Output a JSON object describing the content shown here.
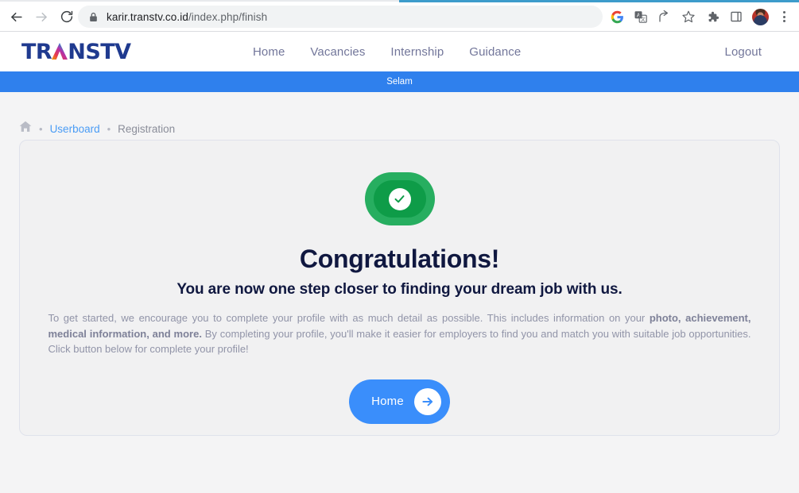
{
  "browser": {
    "back_label": "Back",
    "forward_label": "Forward",
    "reload_label": "Reload",
    "url_host_strong": "karir.transtv.co.id",
    "url_path": "/index.php/finish",
    "url_full": "karir.transtv.co.id/index.php/finish",
    "icons": [
      "google-icon",
      "translate-icon",
      "share-icon",
      "bookmark-star-icon",
      "extensions-puzzle-icon",
      "side-panel-icon",
      "profile-avatar",
      "chrome-menu-icon"
    ]
  },
  "site_header": {
    "brand_part1": "TR",
    "brand_part_a": "A",
    "brand_part2": "NS",
    "brand_part3": "TV",
    "brand_full": "TRANSTV",
    "nav": [
      {
        "label": "Home"
      },
      {
        "label": "Vacancies"
      },
      {
        "label": "Internship"
      },
      {
        "label": "Guidance"
      }
    ],
    "logout_label": "Logout"
  },
  "alert_banner": {
    "message": "Selam",
    "color": "#2f80ed"
  },
  "breadcrumb": {
    "home_icon": "home-icon",
    "separator": "•",
    "items": [
      {
        "label": "Userboard",
        "link": true
      },
      {
        "label": "Registration",
        "link": false
      }
    ]
  },
  "card": {
    "badge_icon": "check-circle-icon",
    "badge_color_outer": "#27ae60",
    "badge_color_inner": "#0e9c48",
    "title": "Congratulations!",
    "subtitle": "You are now one step closer to finding your dream job with us.",
    "body_part1": "To get started, we encourage you to complete your profile with as much detail as possible. This includes information on your ",
    "body_bold1": "photo, achievement, medical information, and more.",
    "body_part2": " By completing your profile, you'll make it easier for employers to find you and match you with suitable job opportunities. Click button below for complete your profile!",
    "button_label": "Home",
    "button_icon": "arrow-right-icon",
    "button_color": "#3a8efb"
  }
}
